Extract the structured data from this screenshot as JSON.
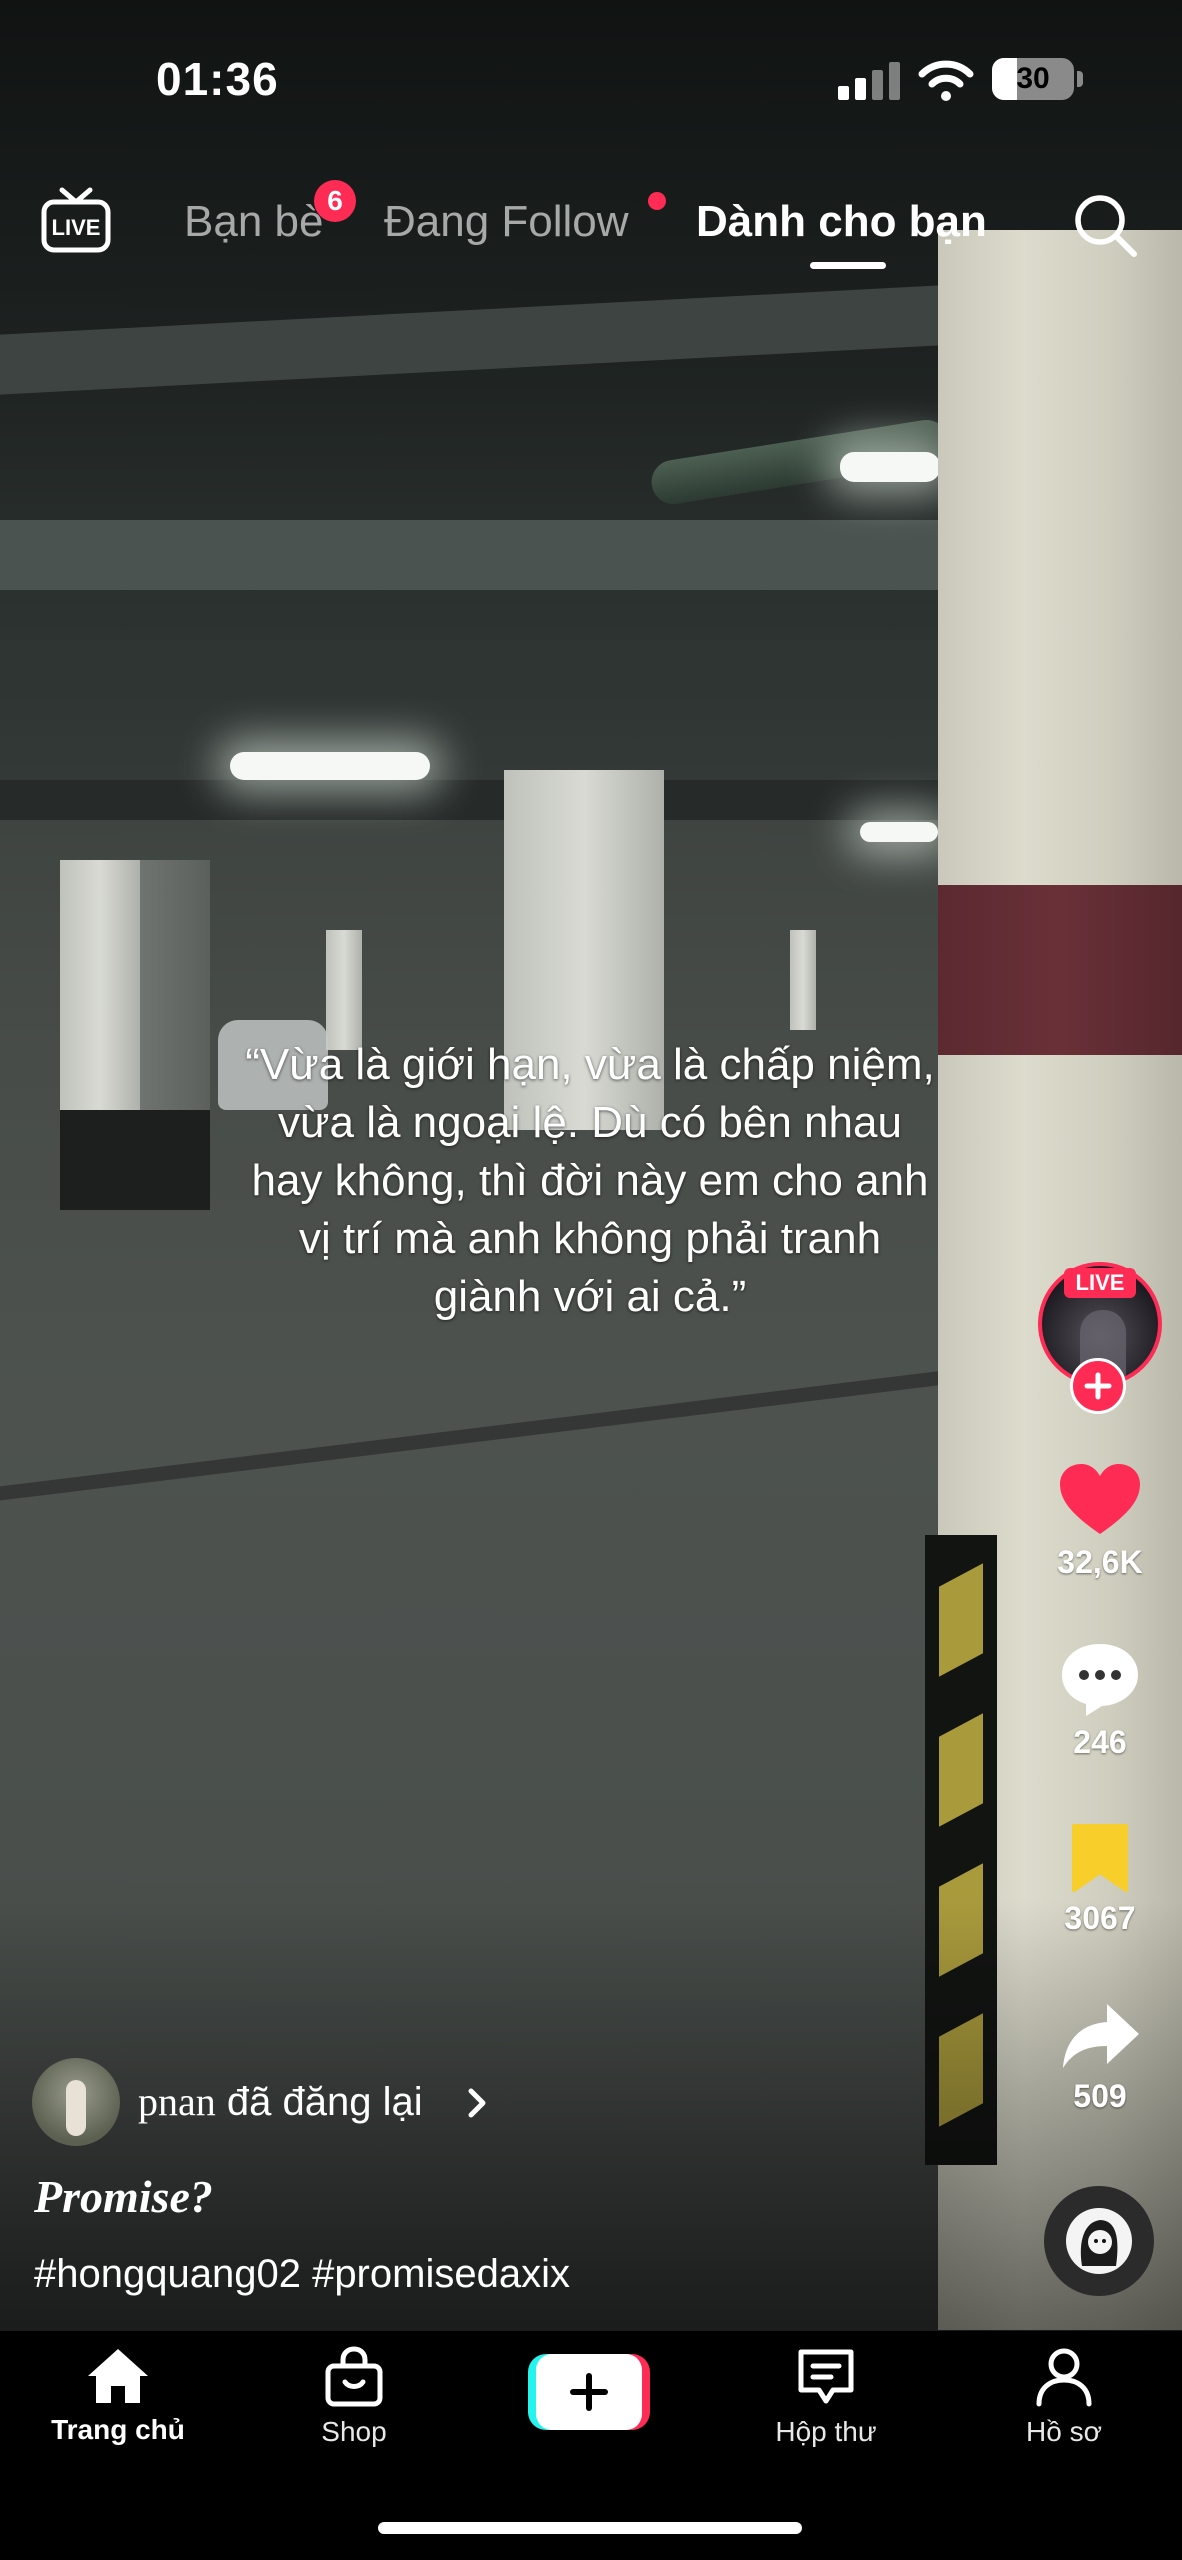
{
  "status_bar": {
    "time": "01:36",
    "battery_level": "30"
  },
  "top_nav": {
    "live_label": "LIVE",
    "tabs": [
      {
        "label": "Bạn bè",
        "badge": "6"
      },
      {
        "label": "Đang Follow",
        "has_dot": true
      },
      {
        "label": "Dành cho bạn",
        "active": true
      }
    ]
  },
  "video": {
    "caption_overlay": "“Vừa là giới hạn, vừa là chấp niệm, vừa là ngoại lệ. Dù có bên nhau hay không, thì đời này em cho anh vị trí mà anh không phải tranh giành với ai cả.”"
  },
  "creator": {
    "live_label": "LIVE"
  },
  "actions": {
    "likes": "32,6K",
    "comments": "246",
    "saves": "3067",
    "shares": "509"
  },
  "repost": {
    "username": "pnan",
    "text": "đã đăng lại"
  },
  "post": {
    "title": "Promise?",
    "hashtags": "#hongquang02 #promisedaxix"
  },
  "bottom_nav": {
    "home": "Trang chủ",
    "shop": "Shop",
    "inbox": "Hộp thư",
    "profile": "Hồ sơ"
  },
  "colors": {
    "accent": "#fe2c55",
    "accent_cyan": "#25f4ee",
    "save_yellow": "#f8cf2a",
    "background": "#000000"
  }
}
